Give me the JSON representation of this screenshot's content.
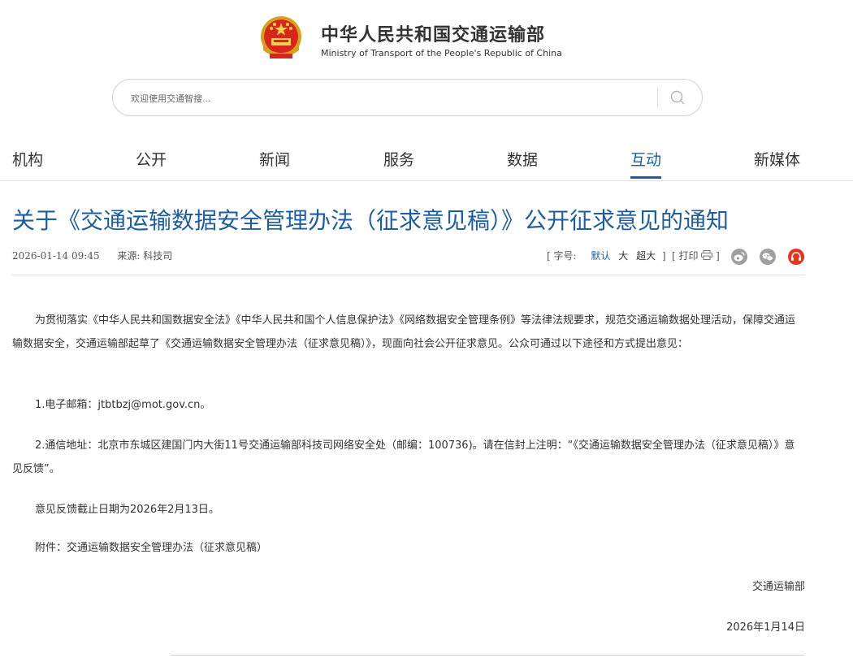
{
  "header": {
    "site_name_cn": "中华人民共和国交通运输部",
    "site_name_en": "Ministry of Transport of the People's Republic of China",
    "search_placeholder": "欢迎使用交通智搜..."
  },
  "nav": {
    "items": [
      {
        "label": "机构"
      },
      {
        "label": "公开"
      },
      {
        "label": "新闻"
      },
      {
        "label": "服务"
      },
      {
        "label": "数据"
      },
      {
        "label": "互动",
        "active": true
      },
      {
        "label": "新媒体"
      }
    ]
  },
  "article": {
    "title": "关于《交通运输数据安全管理办法（征求意见稿）》公开征求意见的通知",
    "date": "2026-01-14 09:45",
    "source": "来源: 科技司",
    "font_size_label": "[ 字号:",
    "font_sizes": [
      "默认",
      "大",
      "超大"
    ],
    "font_size_close": "]",
    "print_label": "[ 打印",
    "print_close": "]",
    "intro": "为贯彻落实《中华人民共和国数据安全法》《中华人民共和国个人信息保护法》《网络数据安全管理条例》等法律法规要求，规范交通运输数据处理活动，保障交通运输数据安全，交通运输部起草了《交通运输数据安全管理办法（征求意见稿）》，现面向社会公开征求意见。公众可通过以下途径和方式提出意见：",
    "email_item": "1.电子邮箱：jtbtbzj@mot.gov.cn。",
    "address_item": "2.通信地址：北京市东城区建国门内大街11号交通运输部科技司网络安全处（邮编：100736)。请在信封上注明：“《交通运输数据安全管理办法（征求意见稿）》意见反馈”。",
    "deadline": "意见反馈截止日期为2026年2月13日。",
    "attachment": "附件：交通运输数据安全管理办法（征求意见稿）",
    "signature": "交通运输部",
    "sign_date": "2026年1月14日"
  },
  "colors": {
    "accent": "#1a5fa5",
    "title": "#1c5e9f",
    "share_red": "#e8331e"
  },
  "icons": [
    "national-emblem-icon",
    "search-icon",
    "print-icon",
    "weibo-icon",
    "wechat-icon",
    "share-icon"
  ]
}
